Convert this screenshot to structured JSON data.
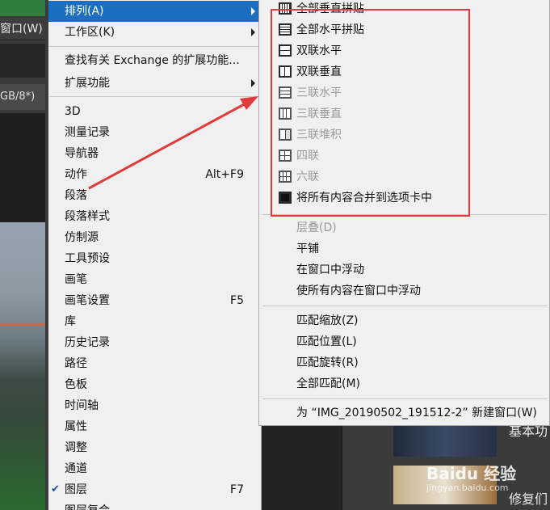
{
  "background": {
    "window_tab": "窗口(W)",
    "doc_tab": "GB/8*)",
    "right_text_1": "基本功",
    "right_text_2": "修复们",
    "watermark": "Baidu 经验",
    "watermark_url": "jingyan.baidu.com"
  },
  "main_menu": {
    "items": [
      {
        "label": "排列(A)",
        "highlighted": true,
        "submenu": true
      },
      {
        "label": "工作区(K)",
        "submenu": true
      },
      {
        "label": "查找有关 Exchange 的扩展功能..."
      },
      {
        "label": "扩展功能",
        "submenu": true
      },
      {
        "label": "3D"
      },
      {
        "label": "测量记录"
      },
      {
        "label": "导航器"
      },
      {
        "label": "动作",
        "shortcut": "Alt+F9"
      },
      {
        "label": "段落"
      },
      {
        "label": "段落样式"
      },
      {
        "label": "仿制源"
      },
      {
        "label": "工具预设"
      },
      {
        "label": "画笔"
      },
      {
        "label": "画笔设置",
        "shortcut": "F5"
      },
      {
        "label": "库"
      },
      {
        "label": "历史记录"
      },
      {
        "label": "路径"
      },
      {
        "label": "色板"
      },
      {
        "label": "时间轴"
      },
      {
        "label": "属性"
      },
      {
        "label": "调整"
      },
      {
        "label": "通道"
      },
      {
        "label": "图层",
        "shortcut": "F7",
        "checked": true
      },
      {
        "label": "图层复合"
      }
    ]
  },
  "sub_menu": {
    "items": [
      {
        "label": "全部垂直拼贴",
        "icon": "tile-vertical-all-icon"
      },
      {
        "label": "全部水平拼贴",
        "icon": "tile-horizontal-all-icon"
      },
      {
        "label": "双联水平",
        "icon": "two-up-horizontal-icon"
      },
      {
        "label": "双联垂直",
        "icon": "two-up-vertical-icon"
      },
      {
        "label": "三联水平",
        "icon": "three-up-horizontal-icon",
        "disabled": true
      },
      {
        "label": "三联垂直",
        "icon": "three-up-vertical-icon",
        "disabled": true
      },
      {
        "label": "三联堆积",
        "icon": "three-up-stacked-icon",
        "disabled": true
      },
      {
        "label": "四联",
        "icon": "four-up-icon",
        "disabled": true
      },
      {
        "label": "六联",
        "icon": "six-up-icon",
        "disabled": true
      },
      {
        "label": "将所有内容合并到选项卡中",
        "icon": "consolidate-tabs-icon"
      },
      {
        "label": "层叠(D)",
        "disabled": true
      },
      {
        "label": "平铺"
      },
      {
        "label": "在窗口中浮动"
      },
      {
        "label": "使所有内容在窗口中浮动"
      },
      {
        "label": "匹配缩放(Z)"
      },
      {
        "label": "匹配位置(L)"
      },
      {
        "label": "匹配旋转(R)"
      },
      {
        "label": "全部匹配(M)"
      },
      {
        "label": "为 “IMG_20190502_191512-2” 新建窗口(W)"
      }
    ]
  },
  "colors": {
    "highlight": "#1c6ec2",
    "annotation": "#e03a3a",
    "menu_bg": "#f0f0f0"
  }
}
